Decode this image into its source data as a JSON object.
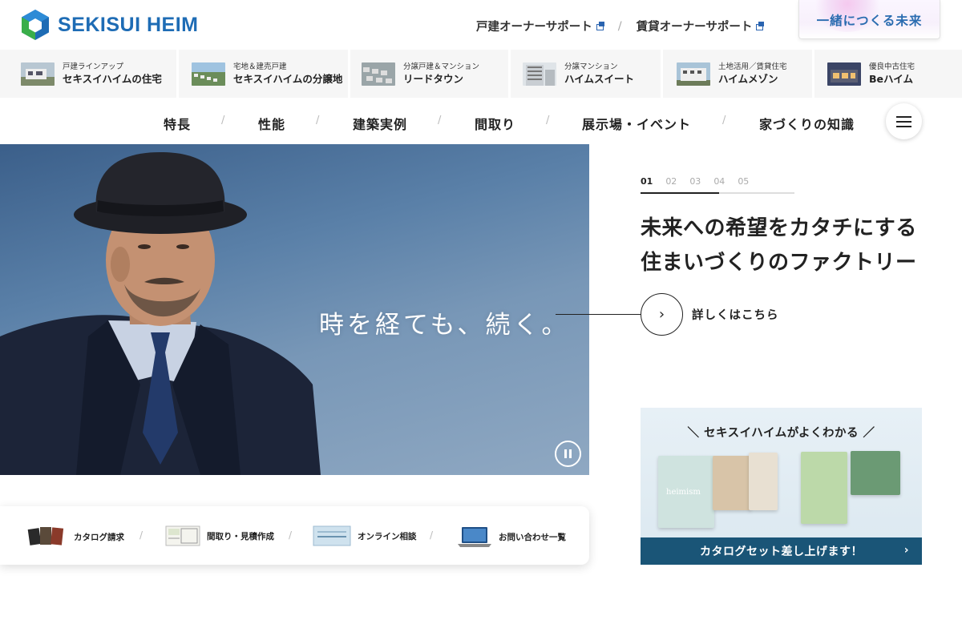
{
  "header": {
    "logo_text": "SEKISUI HEIM",
    "support_links": [
      "戸建オーナーサポート",
      "賃貸オーナーサポート"
    ],
    "future_label": "一緒につくる未来"
  },
  "lineup": [
    {
      "sub": "戸建ラインアップ",
      "main": "セキスイハイムの住宅"
    },
    {
      "sub": "宅地＆建売戸建",
      "main": "セキスイハイムの分譲地"
    },
    {
      "sub": "分譲戸建＆マンション",
      "main": "リードタウン"
    },
    {
      "sub": "分譲マンション",
      "main": "ハイムスイート"
    },
    {
      "sub": "土地活用／賃貸住宅",
      "main": "ハイムメゾン"
    },
    {
      "sub": "優良中古住宅",
      "main": "Beハイム"
    }
  ],
  "nav": [
    "特長",
    "性能",
    "建築実例",
    "間取り",
    "展示場・イベント",
    "家づくりの知識"
  ],
  "hero": {
    "copy": "時を経ても、続く。"
  },
  "slider": {
    "numbers": [
      "01",
      "02",
      "03",
      "04",
      "05"
    ],
    "title_line1": "未来への希望をカタチにする",
    "title_line2": "住まいづくりのファクトリー",
    "detail_label": "詳しくはこちら"
  },
  "quick_links": [
    "カタログ請求",
    "間取り・見積作成",
    "オンライン相談",
    "お問い合わせ一覧"
  ],
  "catalog_banner": {
    "head": "＼ セキスイハイムがよくわかる ／",
    "book_label": "heimism",
    "cta": "カタログセット差し上げます！"
  },
  "colors": {
    "brand_blue": "#1e6cb5",
    "banner_navy": "#1a5577"
  }
}
